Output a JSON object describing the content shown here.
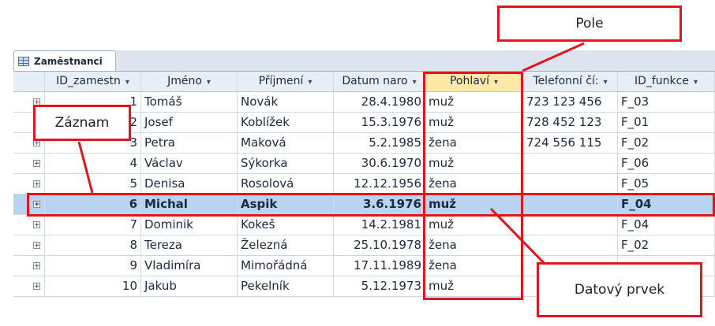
{
  "table_tab": {
    "label": "Zaměstnanci",
    "icon": "table-icon"
  },
  "columns": [
    "ID_zamestn",
    "Jméno",
    "Příjmení",
    "Datum naro",
    "Pohlaví",
    "Telefonní čí:",
    "ID_funkce"
  ],
  "rows": [
    {
      "id": "1",
      "jmeno": "Tomáš",
      "prijmeni": "Novák",
      "datum": "28.4.1980",
      "pohlavi": "muž",
      "telefon": "723 123 456",
      "funkce": "F_03"
    },
    {
      "id": "2",
      "jmeno": "Josef",
      "prijmeni": "Koblížek",
      "datum": "15.3.1976",
      "pohlavi": "muž",
      "telefon": "728 452 123",
      "funkce": "F_01"
    },
    {
      "id": "3",
      "jmeno": "Petra",
      "prijmeni": "Maková",
      "datum": "5.2.1985",
      "pohlavi": "žena",
      "telefon": "724 556 115",
      "funkce": "F_02"
    },
    {
      "id": "4",
      "jmeno": "Václav",
      "prijmeni": "Sýkorka",
      "datum": "30.6.1970",
      "pohlavi": "muž",
      "telefon": "",
      "funkce": "F_06"
    },
    {
      "id": "5",
      "jmeno": "Denisa",
      "prijmeni": "Rosolová",
      "datum": "12.12.1956",
      "pohlavi": "žena",
      "telefon": "",
      "funkce": "F_05"
    },
    {
      "id": "6",
      "jmeno": "Michal",
      "prijmeni": "Aspik",
      "datum": "3.6.1976",
      "pohlavi": "muž",
      "telefon": "",
      "funkce": "F_04"
    },
    {
      "id": "7",
      "jmeno": "Dominik",
      "prijmeni": "Kokeš",
      "datum": "14.2.1981",
      "pohlavi": "muž",
      "telefon": "",
      "funkce": "F_04"
    },
    {
      "id": "8",
      "jmeno": "Tereza",
      "prijmeni": "Železná",
      "datum": "25.10.1978",
      "pohlavi": "žena",
      "telefon": "",
      "funkce": "F_02"
    },
    {
      "id": "9",
      "jmeno": "Vladimíra",
      "prijmeni": "Mimořádná",
      "datum": "17.11.1989",
      "pohlavi": "žena",
      "telefon": "",
      "funkce": ""
    },
    {
      "id": "10",
      "jmeno": "Jakub",
      "prijmeni": "Pekelník",
      "datum": "5.12.1973",
      "pohlavi": "muž",
      "telefon": "",
      "funkce": ""
    }
  ],
  "selected_row": 5,
  "annotations": {
    "pole": "Pole",
    "zaznam": "Záznam",
    "datovy_prvek": "Datový prvek",
    "color": "#e3141b"
  }
}
